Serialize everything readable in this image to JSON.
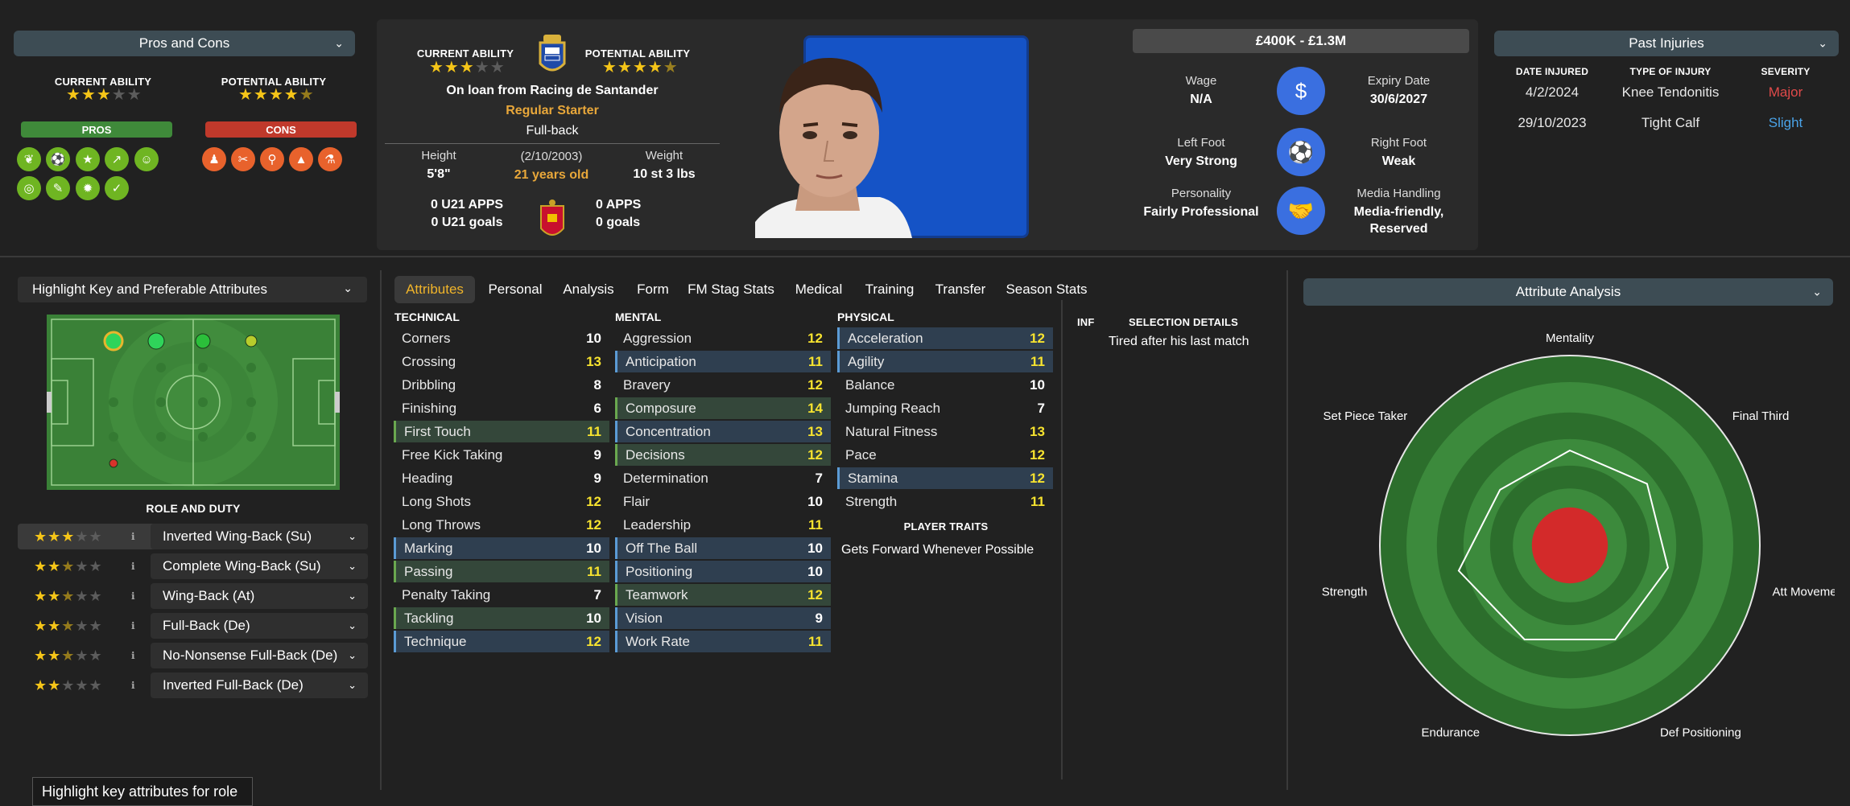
{
  "pros_cons": {
    "title": "Pros and Cons",
    "current_ability_label": "CURRENT ABILITY",
    "potential_ability_label": "POTENTIAL ABILITY",
    "current_stars": "★★★",
    "current_stars_off": "★★",
    "potential_stars": "★★★★",
    "potential_half": "★",
    "pros_label": "PROS",
    "cons_label": "CONS",
    "pros_icons": [
      "leaf-icon",
      "ball-icon",
      "star-icon",
      "trend-icon",
      "head-icon",
      "target-icon",
      "brush-icon",
      "gear-icon",
      "clipboard-icon"
    ],
    "cons_icons": [
      "foot-icon",
      "sprint-icon",
      "search-icon",
      "cone-icon",
      "flask-icon"
    ],
    "pro_glyphs": [
      "❦",
      "⚽",
      "★",
      "↗",
      "☺",
      "◎",
      "✎",
      "✹",
      "✓"
    ],
    "con_glyphs": [
      "♟",
      "✂",
      "⚲",
      "▲",
      "⚗"
    ]
  },
  "profile": {
    "current_ability_label": "CURRENT ABILITY",
    "potential_ability_label": "POTENTIAL ABILITY",
    "current_stars": "★★★",
    "current_stars_off": "★★",
    "potential_stars": "★★★★",
    "potential_half": "★",
    "loan": "On loan from Racing de Santander",
    "status": "Regular Starter",
    "position": "Full-back",
    "height_label": "Height",
    "height": "5'8\"",
    "dob": "(2/10/2003)",
    "age": "21 years old",
    "weight_label": "Weight",
    "weight": "10 st 3 lbs",
    "u21_apps": "0 U21 APPS",
    "u21_goals": "0 U21 goals",
    "apps": "0 APPS",
    "goals": "0 goals"
  },
  "contract": {
    "value": "£400K - £1.3M",
    "wage_label": "Wage",
    "wage": "N/A",
    "expiry_label": "Expiry Date",
    "expiry": "30/6/2027",
    "left_foot_label": "Left Foot",
    "left_foot": "Very Strong",
    "right_foot_label": "Right Foot",
    "right_foot": "Weak",
    "personality_label": "Personality",
    "personality": "Fairly Professional",
    "media_label": "Media Handling",
    "media_1": "Media-friendly,",
    "media_2": "Reserved"
  },
  "injuries": {
    "title": "Past Injuries",
    "col_date": "DATE INJURED",
    "col_type": "TYPE OF INJURY",
    "col_severity": "SEVERITY",
    "rows": [
      {
        "date": "4/2/2024",
        "type": "Knee Tendonitis",
        "severity": "Major"
      },
      {
        "date": "29/10/2023",
        "type": "Tight Calf",
        "severity": "Slight"
      }
    ],
    "severity_colors": {
      "Major": "#e04a4a",
      "Slight": "#4aa3e8"
    }
  },
  "highlight": {
    "title": "Highlight Key and Preferable Attributes",
    "role_duty_label": "ROLE AND DUTY",
    "tooltip": "Highlight key attributes for role",
    "roles": [
      {
        "name": "Inverted Wing-Back (Su)",
        "on": "★★★",
        "off": "★★"
      },
      {
        "name": "Complete Wing-Back (Su)",
        "on": "★★",
        "half": "★",
        "off": "★★"
      },
      {
        "name": "Wing-Back (At)",
        "on": "★★",
        "half": "★",
        "off": "★★"
      },
      {
        "name": "Full-Back (De)",
        "on": "★★",
        "half": "★",
        "off": "★★"
      },
      {
        "name": "No-Nonsense Full-Back (De)",
        "on": "★★",
        "half": "★",
        "off": "★★"
      },
      {
        "name": "Inverted Full-Back (De)",
        "on": "★★",
        "off": "★★★"
      }
    ]
  },
  "tabs": [
    "Attributes",
    "Personal",
    "Analysis",
    "Form",
    "FM Stag Stats",
    "Medical",
    "Training",
    "Transfer",
    "Season Stats"
  ],
  "attributes": {
    "technical_label": "TECHNICAL",
    "mental_label": "MENTAL",
    "physical_label": "PHYSICAL",
    "traits_label": "PLAYER TRAITS",
    "trait": "Gets Forward Whenever Possible",
    "technical": [
      [
        "Corners",
        "10",
        ""
      ],
      [
        "Crossing",
        "13",
        "y"
      ],
      [
        "Dribbling",
        "8",
        ""
      ],
      [
        "Finishing",
        "6",
        ""
      ],
      [
        "First Touch",
        "11",
        "g"
      ],
      [
        "Free Kick Taking",
        "9",
        ""
      ],
      [
        "Heading",
        "9",
        ""
      ],
      [
        "Long Shots",
        "12",
        ""
      ],
      [
        "Long Throws",
        "12",
        ""
      ],
      [
        "Marking",
        "10",
        "b"
      ],
      [
        "Passing",
        "11",
        "g"
      ],
      [
        "Penalty Taking",
        "7",
        ""
      ],
      [
        "Tackling",
        "10",
        "g"
      ],
      [
        "Technique",
        "12",
        "b"
      ]
    ],
    "mental": [
      [
        "Aggression",
        "12",
        ""
      ],
      [
        "Anticipation",
        "11",
        "b"
      ],
      [
        "Bravery",
        "12",
        ""
      ],
      [
        "Composure",
        "14",
        "g"
      ],
      [
        "Concentration",
        "13",
        "b"
      ],
      [
        "Decisions",
        "12",
        "g"
      ],
      [
        "Determination",
        "7",
        ""
      ],
      [
        "Flair",
        "10",
        ""
      ],
      [
        "Leadership",
        "11",
        ""
      ],
      [
        "Off The Ball",
        "10",
        "b"
      ],
      [
        "Positioning",
        "10",
        "b"
      ],
      [
        "Teamwork",
        "12",
        "g"
      ],
      [
        "Vision",
        "9",
        "b"
      ],
      [
        "Work Rate",
        "11",
        "b"
      ]
    ],
    "physical": [
      [
        "Acceleration",
        "12",
        "b"
      ],
      [
        "Agility",
        "11",
        "b"
      ],
      [
        "Balance",
        "10",
        ""
      ],
      [
        "Jumping Reach",
        "7",
        ""
      ],
      [
        "Natural Fitness",
        "13",
        ""
      ],
      [
        "Pace",
        "12",
        ""
      ],
      [
        "Stamina",
        "12",
        "b"
      ],
      [
        "Strength",
        "11",
        ""
      ]
    ]
  },
  "selection": {
    "inf_label": "INF",
    "title": "SELECTION DETAILS",
    "text": "Tired after his last match"
  },
  "analysis": {
    "title": "Attribute Analysis",
    "axes": [
      "Mentality",
      "Final Third",
      "Att Movement",
      "Def Positioning",
      "Endurance",
      "Strength",
      "Set Piece Taker"
    ],
    "values": [
      0.5,
      0.52,
      0.53,
      0.55,
      0.55,
      0.6,
      0.47
    ]
  }
}
